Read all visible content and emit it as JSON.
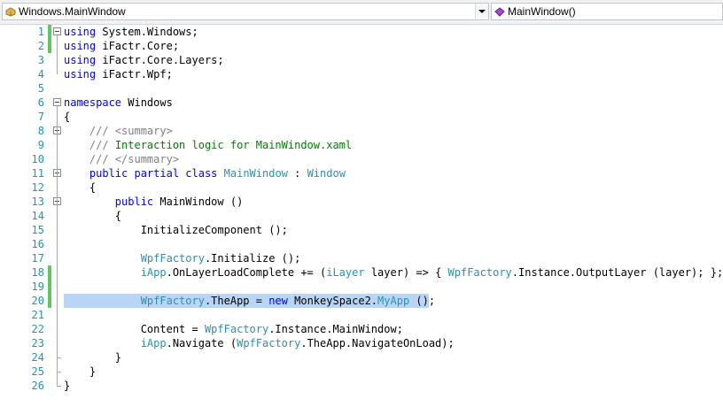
{
  "navbar": {
    "type_combo": {
      "icon": "class-icon",
      "label": "Windows.MainWindow"
    },
    "member_combo": {
      "icon": "method-icon",
      "label": "MainWindow()"
    }
  },
  "editor": {
    "colors": {
      "keyword": "#0000ff",
      "type": "#2b91af",
      "comment": "#008000",
      "line_number": "#2b91af",
      "change_marker": "#62c462",
      "selection": "#b9d5f5"
    },
    "highlighted_line": 20,
    "changed_lines": [
      1,
      2,
      18,
      19,
      20
    ],
    "lines": [
      {
        "n": "1",
        "tokens": [
          {
            "t": "using",
            "c": "kw"
          },
          {
            "t": " System.Windows;"
          }
        ]
      },
      {
        "n": "2",
        "tokens": [
          {
            "t": "using",
            "c": "kw"
          },
          {
            "t": " iFactr.Core;"
          }
        ]
      },
      {
        "n": "3",
        "tokens": [
          {
            "t": "using",
            "c": "kw"
          },
          {
            "t": " iFactr.Core.Layers;"
          }
        ]
      },
      {
        "n": "4",
        "tokens": [
          {
            "t": "using",
            "c": "kw"
          },
          {
            "t": " iFactr.Wpf;"
          }
        ]
      },
      {
        "n": "5",
        "tokens": []
      },
      {
        "n": "6",
        "tokens": [
          {
            "t": "namespace",
            "c": "kw"
          },
          {
            "t": " Windows"
          }
        ]
      },
      {
        "n": "7",
        "tokens": [
          {
            "t": "{"
          }
        ]
      },
      {
        "n": "8",
        "tokens": [
          {
            "t": "    "
          },
          {
            "t": "/// <summary>",
            "c": "xd"
          }
        ]
      },
      {
        "n": "9",
        "tokens": [
          {
            "t": "    "
          },
          {
            "t": "/// ",
            "c": "xd"
          },
          {
            "t": "Interaction logic for MainWindow.xaml",
            "c": "cm"
          }
        ]
      },
      {
        "n": "10",
        "tokens": [
          {
            "t": "    "
          },
          {
            "t": "/// </summary>",
            "c": "xd"
          }
        ]
      },
      {
        "n": "11",
        "tokens": [
          {
            "t": "    "
          },
          {
            "t": "public partial class",
            "c": "kw"
          },
          {
            "t": " "
          },
          {
            "t": "MainWindow",
            "c": "ty"
          },
          {
            "t": " : "
          },
          {
            "t": "Window",
            "c": "ty"
          }
        ]
      },
      {
        "n": "12",
        "tokens": [
          {
            "t": "    {"
          }
        ]
      },
      {
        "n": "13",
        "tokens": [
          {
            "t": "        "
          },
          {
            "t": "public",
            "c": "kw"
          },
          {
            "t": " MainWindow ()"
          }
        ]
      },
      {
        "n": "14",
        "tokens": [
          {
            "t": "        {"
          }
        ]
      },
      {
        "n": "15",
        "tokens": [
          {
            "t": "            InitializeComponent ();"
          }
        ]
      },
      {
        "n": "16",
        "tokens": []
      },
      {
        "n": "17",
        "tokens": [
          {
            "t": "            "
          },
          {
            "t": "WpfFactory",
            "c": "ty"
          },
          {
            "t": ".Initialize ();"
          }
        ]
      },
      {
        "n": "18",
        "tokens": [
          {
            "t": "            "
          },
          {
            "t": "iApp",
            "c": "ty"
          },
          {
            "t": ".OnLayerLoadComplete += ("
          },
          {
            "t": "iLayer",
            "c": "ty"
          },
          {
            "t": " layer) => { "
          },
          {
            "t": "WpfFactory",
            "c": "ty"
          },
          {
            "t": ".Instance.OutputLayer (layer); };"
          }
        ]
      },
      {
        "n": "19",
        "tokens": []
      },
      {
        "n": "20",
        "tokens": [
          {
            "t": "            "
          },
          {
            "t": "WpfFactory",
            "c": "ty"
          },
          {
            "t": ".TheApp = "
          },
          {
            "t": "new",
            "c": "kw"
          },
          {
            "t": " MonkeySpace2."
          },
          {
            "t": "MyApp",
            "c": "ty"
          },
          {
            "t": " ();"
          }
        ]
      },
      {
        "n": "21",
        "tokens": []
      },
      {
        "n": "22",
        "tokens": [
          {
            "t": "            Content = "
          },
          {
            "t": "WpfFactory",
            "c": "ty"
          },
          {
            "t": ".Instance.MainWindow;"
          }
        ]
      },
      {
        "n": "23",
        "tokens": [
          {
            "t": "            "
          },
          {
            "t": "iApp",
            "c": "ty"
          },
          {
            "t": ".Navigate ("
          },
          {
            "t": "WpfFactory",
            "c": "ty"
          },
          {
            "t": ".TheApp.NavigateOnLoad);"
          }
        ]
      },
      {
        "n": "24",
        "tokens": [
          {
            "t": "        }"
          }
        ]
      },
      {
        "n": "25",
        "tokens": [
          {
            "t": "    }"
          }
        ]
      },
      {
        "n": "26",
        "tokens": [
          {
            "t": "}"
          }
        ]
      }
    ]
  }
}
